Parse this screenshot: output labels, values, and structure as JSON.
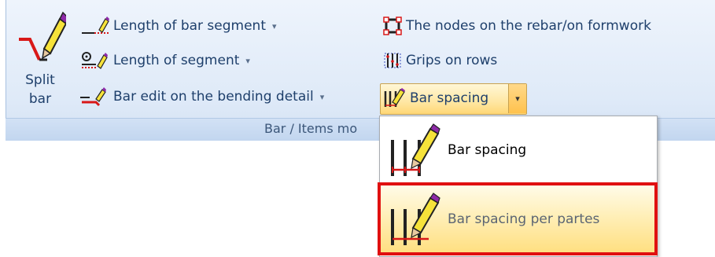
{
  "ribbon": {
    "split_bar": {
      "line1": "Split",
      "line2": "bar"
    },
    "length_of_bar_segment": "Length of bar segment",
    "length_of_segment": "Length of segment",
    "bar_edit_bending": "Bar edit on the bending detail",
    "nodes_on_rebar": "The nodes on the rebar/on formwork",
    "grips_on_rows": "Grips on rows",
    "bar_spacing": "Bar spacing",
    "dropdown_caret": "▾",
    "group_title": "Bar / Items mo"
  },
  "menu": {
    "items": [
      {
        "label": "Bar spacing"
      },
      {
        "label": "Bar spacing per partes"
      }
    ]
  },
  "colors": {
    "accent": "#ffd775",
    "highlight": "#e01010",
    "ribbon_bg": "#dfeaf8"
  }
}
